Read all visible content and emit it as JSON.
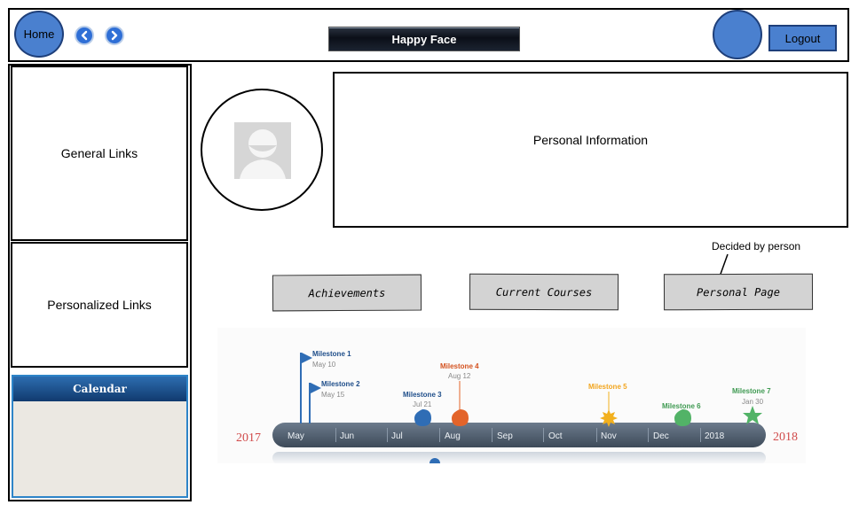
{
  "header": {
    "home_label": "Home",
    "title": "Happy Face",
    "logout_label": "Logout"
  },
  "sidebar": {
    "general_links": "General Links",
    "personalized_links": "Personalized Links",
    "calendar_title": "Calendar"
  },
  "profile": {
    "personal_info": "Personal Information"
  },
  "tabs": {
    "achievements": "Achievements",
    "current_courses": "Current Courses",
    "personal_page": "Personal Page",
    "callout": "Decided by person"
  },
  "timeline": {
    "year_start": "2017",
    "year_end": "2018",
    "months": [
      "May",
      "Jun",
      "Jul",
      "Aug",
      "Sep",
      "Oct",
      "Nov",
      "Dec",
      "2018"
    ],
    "milestones": [
      {
        "label": "Milestone 1",
        "date": "May 10",
        "color": "#2f6db5",
        "shape": "flag"
      },
      {
        "label": "Milestone 2",
        "date": "May 15",
        "color": "#2f6db5",
        "shape": "flag"
      },
      {
        "label": "Milestone 3",
        "date": "Jul 21",
        "color": "#2f6db5",
        "shape": "drop"
      },
      {
        "label": "Milestone 4",
        "date": "Aug 12",
        "color": "#e3642a",
        "shape": "drop"
      },
      {
        "label": "Milestone 5",
        "date": "",
        "color": "#f2b01e",
        "shape": "burst"
      },
      {
        "label": "Milestone 6",
        "date": "",
        "color": "#45a85a",
        "shape": "drop"
      },
      {
        "label": "Milestone 7",
        "date": "Jan 30",
        "color": "#45a85a",
        "shape": "star"
      }
    ],
    "colors": {
      "bar": "#4e5d6e",
      "year_text": "#d14b4b"
    }
  }
}
